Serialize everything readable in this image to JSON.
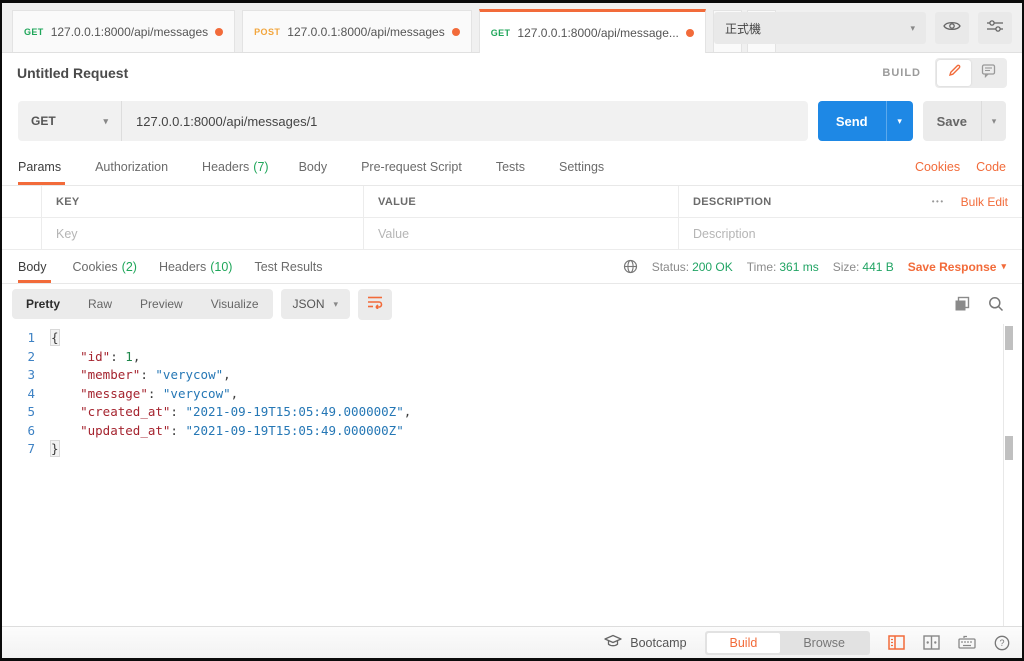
{
  "colors": {
    "accent_orange": "#f26b3a",
    "send_blue": "#1e88e5",
    "success_green": "#21a464",
    "get_green": "#1fa65a",
    "post_amber": "#f2a53c"
  },
  "glyphs": {
    "caret_down": "▾",
    "plus": "+",
    "ellipsis": "•••"
  },
  "tabs": {
    "items": [
      {
        "method": "GET",
        "url": "127.0.0.1:8000/api/messages"
      },
      {
        "method": "POST",
        "url": "127.0.0.1:8000/api/messages"
      },
      {
        "method": "GET",
        "url": "127.0.0.1:8000/api/message..."
      }
    ]
  },
  "environment": {
    "selected": "正式機"
  },
  "request": {
    "title": "Untitled Request",
    "mode_label": "BUILD",
    "method": "GET",
    "url": "127.0.0.1:8000/api/messages/1",
    "send_label": "Send",
    "save_label": "Save",
    "tabs": [
      {
        "label": "Params",
        "count": ""
      },
      {
        "label": "Authorization",
        "count": ""
      },
      {
        "label": "Headers",
        "count": "(7)"
      },
      {
        "label": "Body",
        "count": ""
      },
      {
        "label": "Pre-request Script",
        "count": ""
      },
      {
        "label": "Tests",
        "count": ""
      },
      {
        "label": "Settings",
        "count": ""
      }
    ],
    "cookies_label": "Cookies",
    "code_label": "Code"
  },
  "params": {
    "headers": {
      "key": "KEY",
      "value": "VALUE",
      "description": "DESCRIPTION"
    },
    "bulk_edit_label": "Bulk Edit",
    "placeholders": {
      "key": "Key",
      "value": "Value",
      "description": "Description"
    }
  },
  "response": {
    "tabs": [
      {
        "label": "Body",
        "count": ""
      },
      {
        "label": "Cookies",
        "count": "(2)"
      },
      {
        "label": "Headers",
        "count": "(10)"
      },
      {
        "label": "Test Results",
        "count": ""
      }
    ],
    "status_label": "Status:",
    "status_value": "200 OK",
    "time_label": "Time:",
    "time_value": "361 ms",
    "size_label": "Size:",
    "size_value": "441 B",
    "save_response_label": "Save Response",
    "view_tabs": [
      "Pretty",
      "Raw",
      "Preview",
      "Visualize"
    ],
    "format": "JSON",
    "code": {
      "lines": [
        {
          "n": "1",
          "tokens": [
            {
              "c": "brace",
              "v": "{"
            }
          ]
        },
        {
          "n": "2",
          "tokens": [
            {
              "c": "p",
              "v": "    "
            },
            {
              "c": "key",
              "v": "\"id\""
            },
            {
              "c": "p",
              "v": ": "
            },
            {
              "c": "num",
              "v": "1"
            },
            {
              "c": "p",
              "v": ","
            }
          ]
        },
        {
          "n": "3",
          "tokens": [
            {
              "c": "p",
              "v": "    "
            },
            {
              "c": "key",
              "v": "\"member\""
            },
            {
              "c": "p",
              "v": ": "
            },
            {
              "c": "str",
              "v": "\"verycow\""
            },
            {
              "c": "p",
              "v": ","
            }
          ]
        },
        {
          "n": "4",
          "tokens": [
            {
              "c": "p",
              "v": "    "
            },
            {
              "c": "key",
              "v": "\"message\""
            },
            {
              "c": "p",
              "v": ": "
            },
            {
              "c": "str",
              "v": "\"verycow\""
            },
            {
              "c": "p",
              "v": ","
            }
          ]
        },
        {
          "n": "5",
          "tokens": [
            {
              "c": "p",
              "v": "    "
            },
            {
              "c": "key",
              "v": "\"created_at\""
            },
            {
              "c": "p",
              "v": ": "
            },
            {
              "c": "str",
              "v": "\"2021-09-19T15:05:49.000000Z\""
            },
            {
              "c": "p",
              "v": ","
            }
          ]
        },
        {
          "n": "6",
          "tokens": [
            {
              "c": "p",
              "v": "    "
            },
            {
              "c": "key",
              "v": "\"updated_at\""
            },
            {
              "c": "p",
              "v": ": "
            },
            {
              "c": "str",
              "v": "\"2021-09-19T15:05:49.000000Z\""
            }
          ]
        },
        {
          "n": "7",
          "tokens": [
            {
              "c": "brace",
              "v": "}"
            }
          ]
        }
      ]
    }
  },
  "footer": {
    "bootcamp_label": "Bootcamp",
    "build_label": "Build",
    "browse_label": "Browse"
  }
}
